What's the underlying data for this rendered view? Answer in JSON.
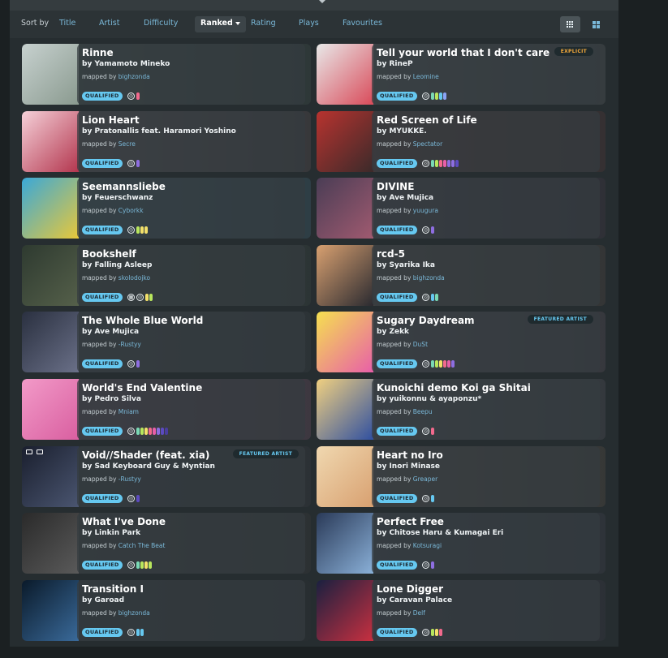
{
  "sort": {
    "label": "Sort by",
    "options": [
      "Title",
      "Artist",
      "Difficulty",
      "Ranked",
      "Rating",
      "Plays",
      "Favourites"
    ],
    "active": "Ranked"
  },
  "colors": {
    "qualified": "#66c8f0",
    "link": "#7ab8d8",
    "explicit": "#f4a93a"
  },
  "beatmaps": [
    {
      "title": "Rinne",
      "artist": "by Yamamoto Mineko",
      "mapped_prefix": "mapped by",
      "mapper": "bighzonda",
      "status": "QUALIFIED",
      "badge": "",
      "dots": [
        "#f26a8d"
      ],
      "cover": [
        "#c7d1cf",
        "#8a9a8f"
      ],
      "bgc": [
        "#4a5955",
        "#2e3a38"
      ]
    },
    {
      "title": "Tell your world that I don't care",
      "artist": "by RineP",
      "mapped_prefix": "mapped by",
      "mapper": "Leomine",
      "status": "QUALIFIED",
      "badge": "EXPLICIT",
      "badge_type": "explicit",
      "dots": [
        "#7ad9b5",
        "#b8e65d",
        "#66c8f0",
        "#8aa3f5"
      ],
      "cover": [
        "#e8e8e8",
        "#d94b5a"
      ],
      "bgc": [
        "#5a5f62",
        "#3d4245"
      ]
    },
    {
      "title": "Lion Heart",
      "artist": "by Pratonallis feat. Haramori Yoshino",
      "mapped_prefix": "mapped by",
      "mapper": "Secre",
      "status": "QUALIFIED",
      "badge": "",
      "dots": [
        "#8e6ee0"
      ],
      "cover": [
        "#f5d0d8",
        "#b3364e"
      ],
      "bgc": [
        "#6a5d62",
        "#3f3a3d"
      ]
    },
    {
      "title": "Red Screen of Life",
      "artist": "by MYUKKE.",
      "mapped_prefix": "mapped by",
      "mapper": "Spectator",
      "status": "QUALIFIED",
      "badge": "",
      "dots": [
        "#7ad9b5",
        "#b8e65d",
        "#f26a8d",
        "#e85fa8",
        "#8e6ee0",
        "#8e6ee0",
        "#5c4bbf"
      ],
      "cover": [
        "#b8332f",
        "#3b2a2a"
      ],
      "bgc": [
        "#5e3c3a",
        "#3b2d2d"
      ]
    },
    {
      "title": "Seemannsliebe",
      "artist": "by Feuerschwanz",
      "mapped_prefix": "mapped by",
      "mapper": "Cyborkk",
      "status": "QUALIFIED",
      "badge": "",
      "dots": [
        "#b8e65d",
        "#f3e06a",
        "#f3e06a"
      ],
      "cover": [
        "#3aa8d8",
        "#e8c83a"
      ],
      "bgc": [
        "#3d6070",
        "#2e4550"
      ]
    },
    {
      "title": "DIVINE",
      "artist": "by Ave Mujica",
      "mapped_prefix": "mapped by",
      "mapper": "yuugura",
      "status": "QUALIFIED",
      "badge": "",
      "dots": [
        "#8e6ee0"
      ],
      "cover": [
        "#4a3d55",
        "#a05a70"
      ],
      "bgc": [
        "#4a4452",
        "#302c36"
      ]
    },
    {
      "title": "Bookshelf",
      "artist": "by Falling Asleep",
      "mapped_prefix": "mapped by",
      "mapper": "skolodojko",
      "status": "QUALIFIED",
      "badge": "",
      "dots": [
        "#f3e06a",
        "#b8e65d"
      ],
      "extra_mode": true,
      "cover": [
        "#2e3a30",
        "#55604a"
      ],
      "bgc": [
        "#3a4540",
        "#2c3533"
      ]
    },
    {
      "title": "rcd-5",
      "artist": "by Syarika Ika",
      "mapped_prefix": "mapped by",
      "mapper": "bighzonda",
      "status": "QUALIFIED",
      "badge": "",
      "dots": [
        "#66c8f0",
        "#7ad9b5"
      ],
      "cover": [
        "#d8a070",
        "#2a2a30"
      ],
      "bgc": [
        "#55504c",
        "#3a3634"
      ]
    },
    {
      "title": "The Whole Blue World",
      "artist": "by Ave Mujica",
      "mapped_prefix": "mapped by",
      "mapper": "-Rustyy",
      "status": "QUALIFIED",
      "badge": "",
      "dots": [
        "#8e6ee0"
      ],
      "cover": [
        "#2a3040",
        "#6a7088"
      ],
      "bgc": [
        "#3c4248",
        "#2c3236"
      ]
    },
    {
      "title": "Sugary Daydream",
      "artist": "by Zekk",
      "mapped_prefix": "mapped by",
      "mapper": "DuSt",
      "status": "QUALIFIED",
      "badge": "FEATURED ARTIST",
      "badge_type": "featured",
      "dots": [
        "#7ad9b5",
        "#b8e65d",
        "#f3e06a",
        "#f26a8d",
        "#e85fa8",
        "#8e6ee0"
      ],
      "cover": [
        "#f5e050",
        "#e85fa8"
      ],
      "bgc": [
        "#5a5560",
        "#3e3a42"
      ]
    },
    {
      "title": "World's End Valentine",
      "artist": "by Pedro Silva",
      "mapped_prefix": "mapped by",
      "mapper": "Mniam",
      "status": "QUALIFIED",
      "badge": "",
      "dots": [
        "#7ad9b5",
        "#b8e65d",
        "#f3e06a",
        "#f26a8d",
        "#e85fa8",
        "#8e6ee0",
        "#5c4bbf",
        "#4a3d9f"
      ],
      "cover": [
        "#f29ac8",
        "#d95fa0"
      ],
      "bgc": [
        "#6a4d62",
        "#4a3a48"
      ]
    },
    {
      "title": "Kunoichi demo Koi ga Shitai",
      "artist": "by yuikonnu & ayaponzu*",
      "mapped_prefix": "mapped by",
      "mapper": "Beepu",
      "status": "QUALIFIED",
      "badge": "",
      "dots": [
        "#f26a8d"
      ],
      "cover": [
        "#f0d080",
        "#3050a0"
      ],
      "bgc": [
        "#55585e",
        "#3a3c42"
      ]
    },
    {
      "title": "Void//Shader (feat. xia)",
      "artist": "by Sad Keyboard Guy & Myntian",
      "mapped_prefix": "mapped by",
      "mapper": "-Rustyy",
      "status": "QUALIFIED",
      "badge": "FEATURED ARTIST",
      "badge_type": "featured",
      "dots": [
        "#5c4bbf"
      ],
      "media": true,
      "cover": [
        "#1a1f2e",
        "#4a5570"
      ],
      "bgc": [
        "#34393f",
        "#2a2e33"
      ]
    },
    {
      "title": "Heart no Iro",
      "artist": "by Inori Minase",
      "mapped_prefix": "mapped by",
      "mapper": "Greaper",
      "status": "QUALIFIED",
      "badge": "",
      "dots": [
        "#66c8f0"
      ],
      "cover": [
        "#f0d8b0",
        "#d8a070"
      ],
      "bgc": [
        "#5e5650",
        "#3e3a36"
      ]
    },
    {
      "title": "What I've Done",
      "artist": "by Linkin Park",
      "mapped_prefix": "mapped by",
      "mapper": "Catch The Beat",
      "status": "QUALIFIED",
      "badge": "",
      "dots": [
        "#7ad9b5",
        "#b8e65d",
        "#f3e06a",
        "#b8e65d"
      ],
      "cover": [
        "#2a2a2a",
        "#5a5a5a"
      ],
      "bgc": [
        "#3c3e40",
        "#2c2e30"
      ]
    },
    {
      "title": "Perfect Free",
      "artist": "by Chitose Haru & Kumagai Eri",
      "mapped_prefix": "mapped by",
      "mapper": "Kotsuragi",
      "status": "QUALIFIED",
      "badge": "",
      "dots": [
        "#8e6ee0"
      ],
      "cover": [
        "#2a3a58",
        "#8ab0d8"
      ],
      "bgc": [
        "#3e4450",
        "#2e323a"
      ]
    },
    {
      "title": "Transition I",
      "artist": "by Garoad",
      "mapped_prefix": "mapped by",
      "mapper": "bighzonda",
      "status": "QUALIFIED",
      "badge": "",
      "dots": [
        "#66c8f0",
        "#66c8f0"
      ],
      "cover": [
        "#0a1a2a",
        "#3a6a9a"
      ],
      "bgc": [
        "#2e343a",
        "#24282c"
      ]
    },
    {
      "title": "Lone Digger",
      "artist": "by Caravan Palace",
      "mapped_prefix": "mapped by",
      "mapper": "Delf",
      "status": "QUALIFIED",
      "badge": "",
      "dots": [
        "#b8e65d",
        "#f3e06a",
        "#f26a8d"
      ],
      "cover": [
        "#1a2040",
        "#c83040"
      ],
      "bgc": [
        "#3a3c48",
        "#2a2c34"
      ]
    }
  ]
}
